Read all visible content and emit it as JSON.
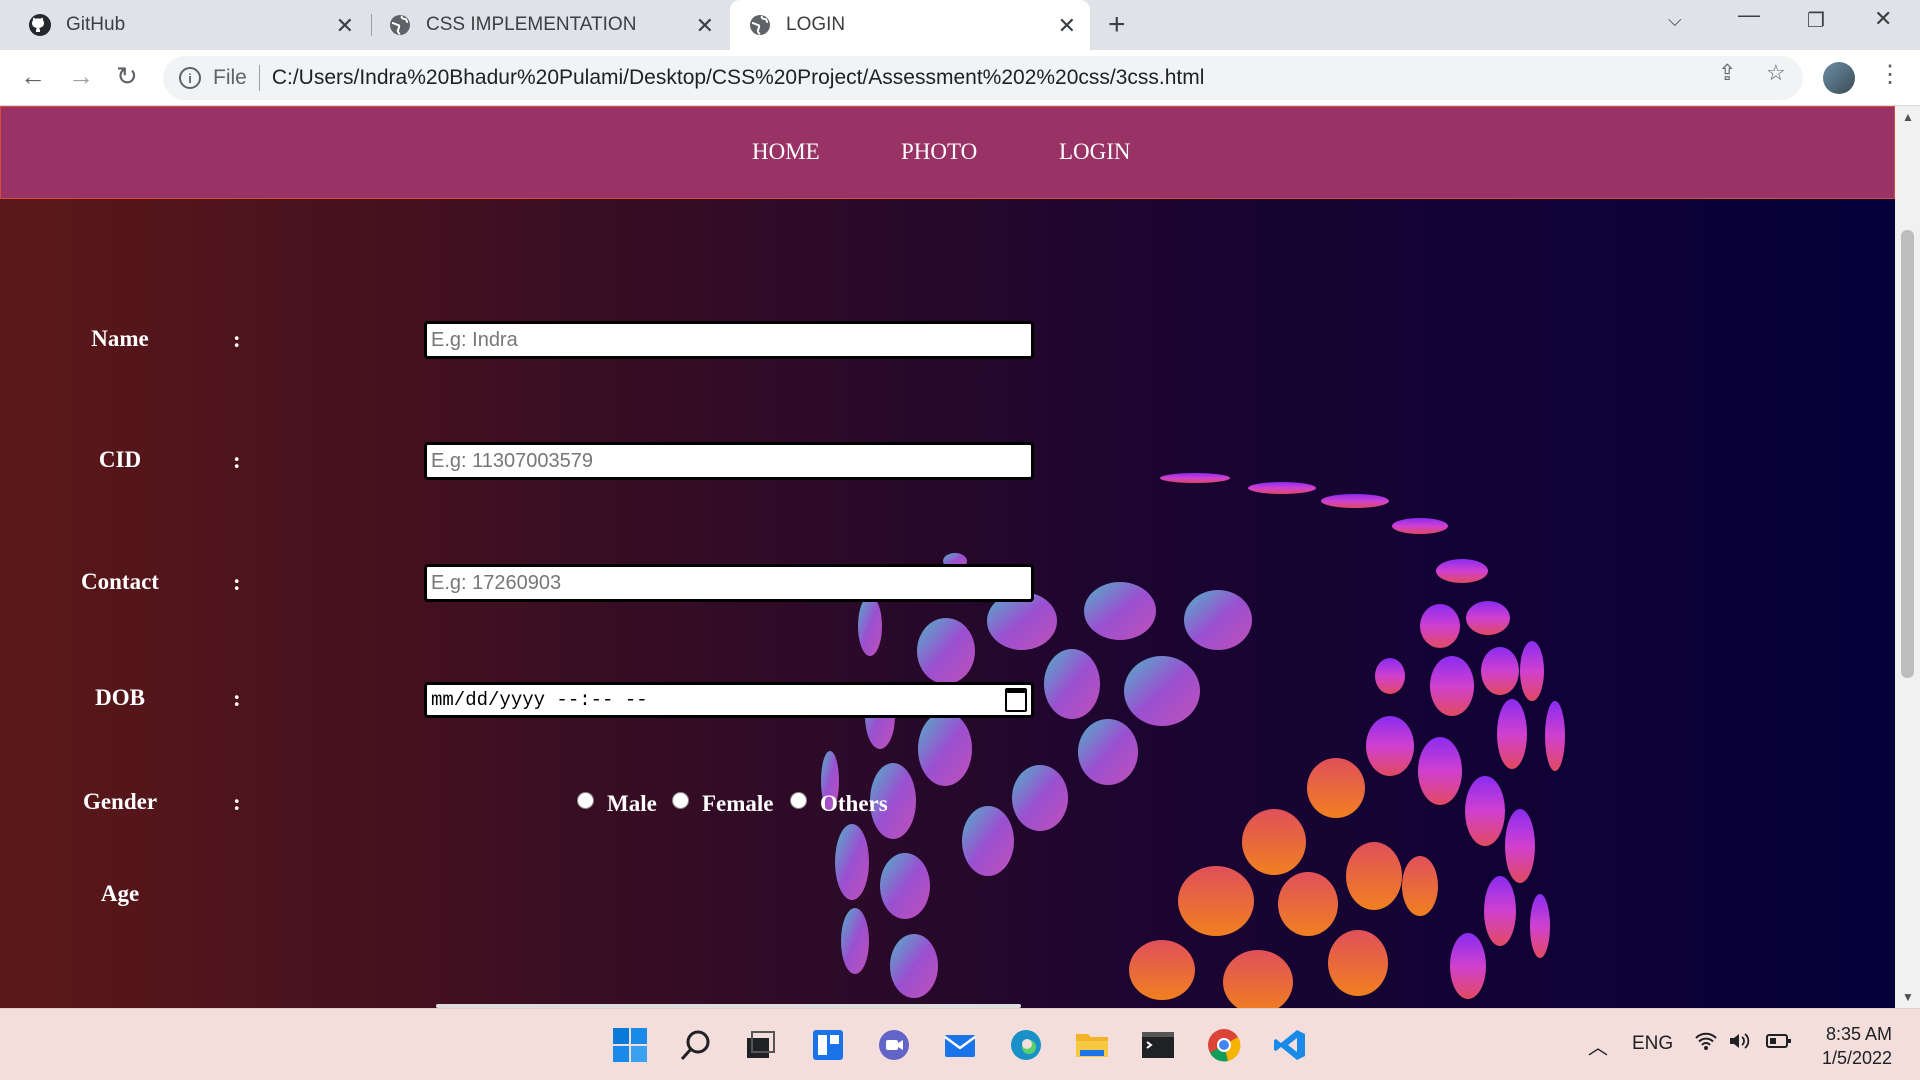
{
  "browser": {
    "tabs": [
      {
        "title": "GitHub",
        "icon": "github-icon"
      },
      {
        "title": "CSS IMPLEMENTATION",
        "icon": "globe-icon"
      },
      {
        "title": "LOGIN",
        "icon": "globe-icon",
        "active": true
      }
    ],
    "address": {
      "scheme_label": "File",
      "url": "C:/Users/Indra%20Bhadur%20Pulami/Desktop/CSS%20Project/Assessment%202%20css/3css.html"
    }
  },
  "nav": {
    "items": [
      "HOME",
      "PHOTO",
      "LOGIN"
    ],
    "bg_color": "#993366"
  },
  "form": {
    "name": {
      "label": "Name",
      "colon": ":",
      "placeholder": "E.g: Indra"
    },
    "cid": {
      "label": "CID",
      "colon": ":",
      "placeholder": "E.g: 11307003579"
    },
    "contact": {
      "label": "Contact",
      "colon": ":",
      "placeholder": "E.g: 17260903"
    },
    "dob": {
      "label": "DOB",
      "colon": ":",
      "value": "mm/dd/yyyy --:-- --"
    },
    "gender": {
      "label": "Gender",
      "colon": ":",
      "options": [
        "Male",
        "Female",
        "Others"
      ]
    },
    "age": {
      "label": "Age"
    }
  },
  "taskbar": {
    "tray": {
      "language": "ENG"
    },
    "clock": {
      "time": "8:35 AM",
      "date": "1/5/2022"
    }
  }
}
